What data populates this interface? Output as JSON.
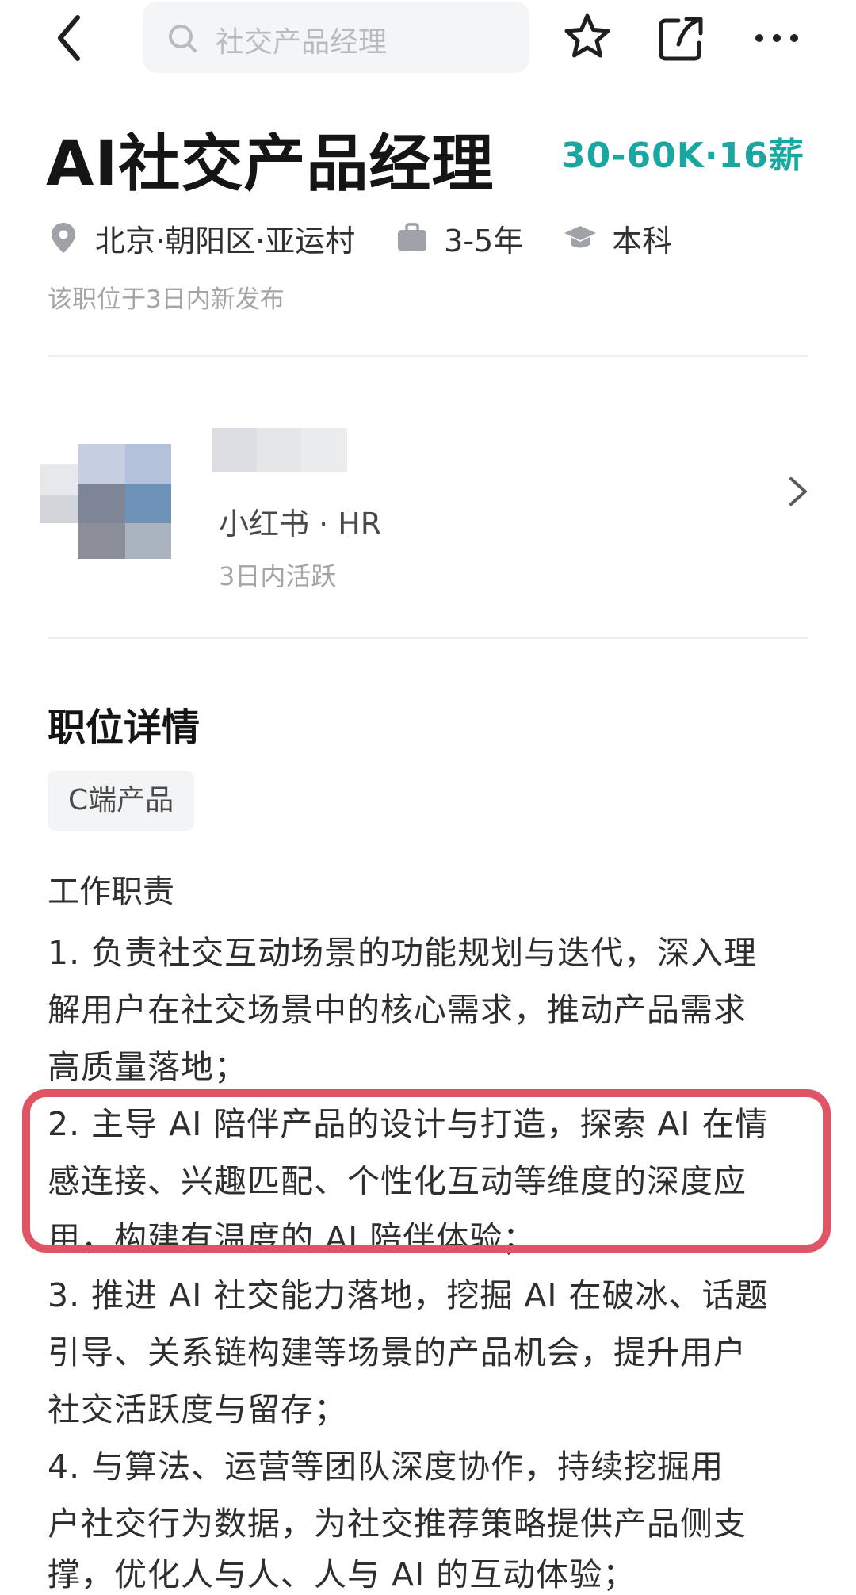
{
  "search": {
    "placeholder": "社交产品经理"
  },
  "job": {
    "title": "AI社交产品经理",
    "salary": "30-60K·16薪",
    "location": "北京·朝阳区·亚运村",
    "experience": "3-5年",
    "education": "本科",
    "posted": "该职位于3日内新发布"
  },
  "hr": {
    "company_role": "小红书 · HR",
    "active": "3日内活跃"
  },
  "details": {
    "section_title": "职位详情",
    "tag": "C端产品",
    "duties_heading": "工作职责",
    "lines": [
      "1. 负责社交互动场景的功能规划与迭代，深入理",
      "解用户在社交场景中的核心需求，推动产品需求",
      "高质量落地；",
      "2. 主导 AI 陪伴产品的设计与打造，探索 AI 在情",
      "感连接、兴趣匹配、个性化互动等维度的深度应",
      "用，构建有温度的 AI 陪伴体验；",
      "3. 推进 AI 社交能力落地，挖掘 AI 在破冰、话题",
      "引导、关系链构建等场景的产品机会，提升用户",
      "社交活跃度与留存；",
      "4. 与算法、运营等团队深度协作，持续挖掘用",
      "户社交行为数据，为社交推荐策略提供产品侧支",
      "撑，优化人与人、人与 AI 的互动体验；"
    ]
  },
  "colors": {
    "accent": "#1aa7a1",
    "highlight": "#e05566"
  }
}
